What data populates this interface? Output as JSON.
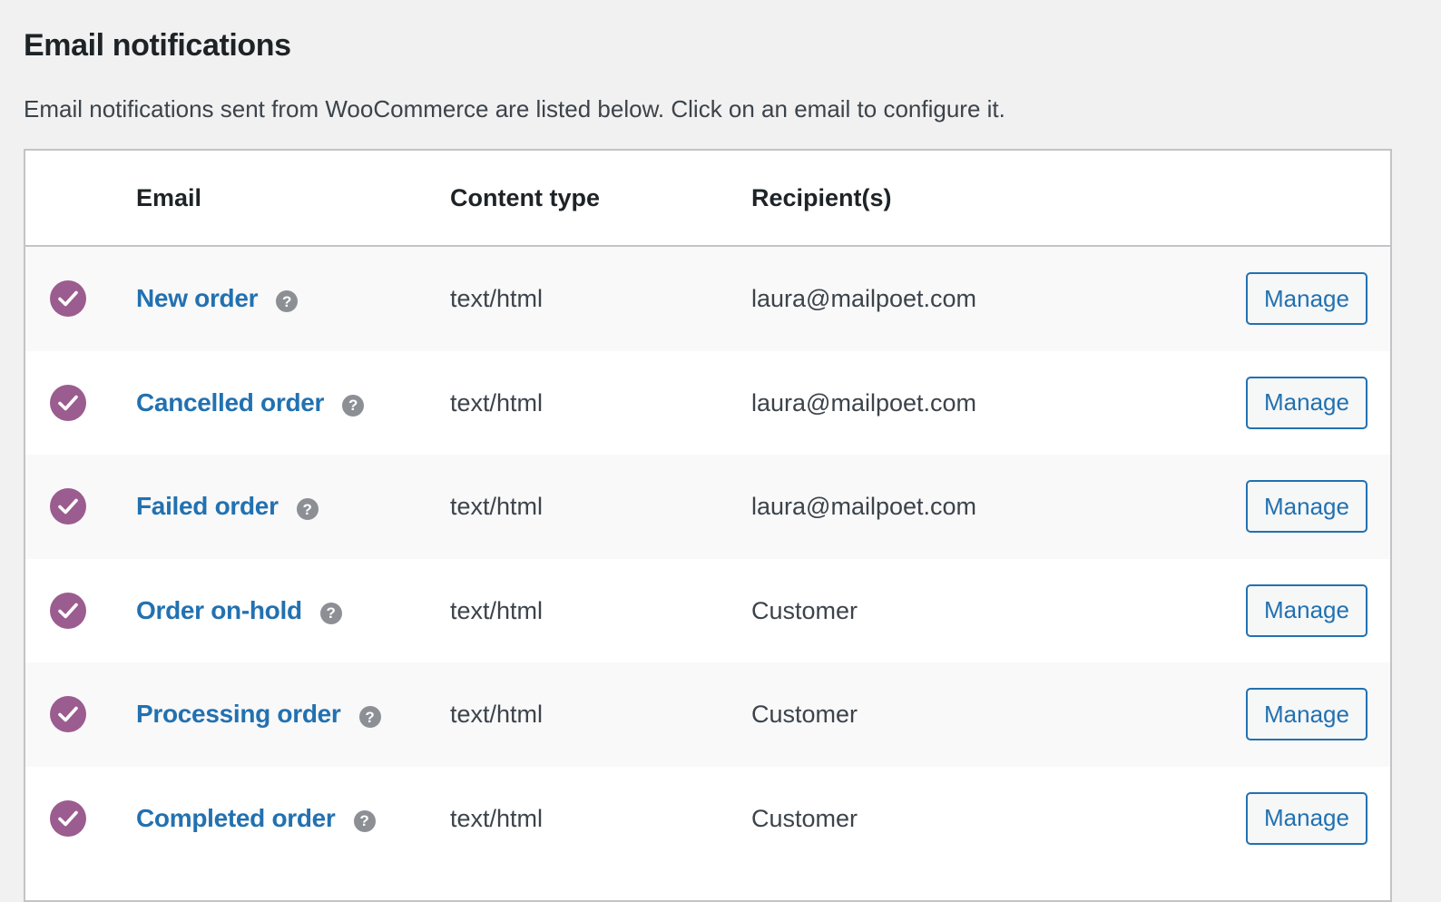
{
  "page": {
    "title": "Email notifications",
    "intro": "Email notifications sent from WooCommerce are listed below. Click on an email to configure it."
  },
  "table": {
    "headers": {
      "email": "Email",
      "content_type": "Content type",
      "recipients": "Recipient(s)"
    },
    "rows": [
      {
        "name": "New order",
        "content_type": "text/html",
        "recipient": "laura@mailpoet.com",
        "status": "enabled",
        "action": "Manage"
      },
      {
        "name": "Cancelled order",
        "content_type": "text/html",
        "recipient": "laura@mailpoet.com",
        "status": "enabled",
        "action": "Manage"
      },
      {
        "name": "Failed order",
        "content_type": "text/html",
        "recipient": "laura@mailpoet.com",
        "status": "enabled",
        "action": "Manage"
      },
      {
        "name": "Order on-hold",
        "content_type": "text/html",
        "recipient": "Customer",
        "status": "enabled",
        "action": "Manage"
      },
      {
        "name": "Processing order",
        "content_type": "text/html",
        "recipient": "Customer",
        "status": "enabled",
        "action": "Manage"
      },
      {
        "name": "Completed order",
        "content_type": "text/html",
        "recipient": "Customer",
        "status": "enabled",
        "action": "Manage"
      }
    ]
  },
  "icons": {
    "status": "check-circle-icon",
    "help": "help-icon",
    "help_glyph": "?"
  },
  "colors": {
    "status_enabled": "#9b5c8f",
    "link": "#2271b1",
    "help_icon": "#8c8f94"
  }
}
